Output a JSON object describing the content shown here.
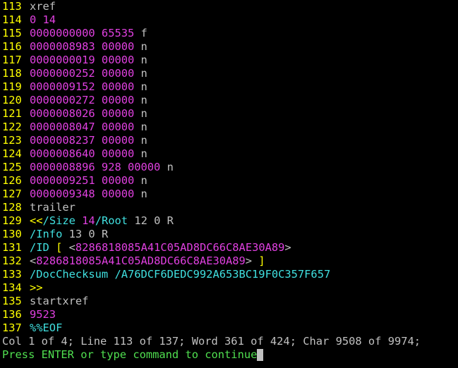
{
  "colors": {
    "background": "#000000",
    "line_number": "#ffff00",
    "plain": "#c0c0c0",
    "number": "#e040e0",
    "keyword": "#40e0e0",
    "bracket": "#ffff00",
    "prompt": "#50e050"
  },
  "lines": [
    {
      "n": "113",
      "segs": [
        {
          "t": "xref",
          "c": "plain"
        }
      ]
    },
    {
      "n": "114",
      "segs": [
        {
          "t": "0 14",
          "c": "num"
        }
      ]
    },
    {
      "n": "115",
      "segs": [
        {
          "t": "0000000000 65535 ",
          "c": "num"
        },
        {
          "t": "f",
          "c": "plain"
        }
      ]
    },
    {
      "n": "116",
      "segs": [
        {
          "t": "0000008983 00000 ",
          "c": "num"
        },
        {
          "t": "n",
          "c": "plain"
        }
      ]
    },
    {
      "n": "117",
      "segs": [
        {
          "t": "0000000019 00000 ",
          "c": "num"
        },
        {
          "t": "n",
          "c": "plain"
        }
      ]
    },
    {
      "n": "118",
      "segs": [
        {
          "t": "0000000252 00000 ",
          "c": "num"
        },
        {
          "t": "n",
          "c": "plain"
        }
      ]
    },
    {
      "n": "119",
      "segs": [
        {
          "t": "0000009152 00000 ",
          "c": "num"
        },
        {
          "t": "n",
          "c": "plain"
        }
      ]
    },
    {
      "n": "120",
      "segs": [
        {
          "t": "0000000272 00000 ",
          "c": "num"
        },
        {
          "t": "n",
          "c": "plain"
        }
      ]
    },
    {
      "n": "121",
      "segs": [
        {
          "t": "0000008026 00000 ",
          "c": "num"
        },
        {
          "t": "n",
          "c": "plain"
        }
      ]
    },
    {
      "n": "122",
      "segs": [
        {
          "t": "0000008047 00000 ",
          "c": "num"
        },
        {
          "t": "n",
          "c": "plain"
        }
      ]
    },
    {
      "n": "123",
      "segs": [
        {
          "t": "0000008237 00000 ",
          "c": "num"
        },
        {
          "t": "n",
          "c": "plain"
        }
      ]
    },
    {
      "n": "124",
      "segs": [
        {
          "t": "0000008640 00000 ",
          "c": "num"
        },
        {
          "t": "n",
          "c": "plain"
        }
      ]
    },
    {
      "n": "125",
      "segs": [
        {
          "t": "0000008896 928 00000 ",
          "c": "num"
        },
        {
          "t": "n",
          "c": "plain"
        }
      ]
    },
    {
      "n": "126",
      "segs": [
        {
          "t": "0000009251 00000 ",
          "c": "num"
        },
        {
          "t": "n",
          "c": "plain"
        }
      ]
    },
    {
      "n": "127",
      "segs": [
        {
          "t": "0000009348 00000 ",
          "c": "num"
        },
        {
          "t": "n",
          "c": "plain"
        }
      ]
    },
    {
      "n": "128",
      "segs": [
        {
          "t": "trailer",
          "c": "plain"
        }
      ]
    },
    {
      "n": "129",
      "segs": [
        {
          "t": "<<",
          "c": "yel"
        },
        {
          "t": "/Size ",
          "c": "kw"
        },
        {
          "t": "14",
          "c": "num"
        },
        {
          "t": "/Root ",
          "c": "kw"
        },
        {
          "t": "12 0 R",
          "c": "plain"
        }
      ]
    },
    {
      "n": "130",
      "segs": [
        {
          "t": "/Info ",
          "c": "kw"
        },
        {
          "t": "13 0 R",
          "c": "plain"
        }
      ]
    },
    {
      "n": "131",
      "segs": [
        {
          "t": "/ID ",
          "c": "kw"
        },
        {
          "t": "[ ",
          "c": "yel"
        },
        {
          "t": "<",
          "c": "plain"
        },
        {
          "t": "8286818085A41C05AD8DC66C8AE30A89",
          "c": "num"
        },
        {
          "t": ">",
          "c": "plain"
        }
      ]
    },
    {
      "n": "132",
      "segs": [
        {
          "t": "<",
          "c": "plain"
        },
        {
          "t": "8286818085A41C05AD8DC66C8AE30A89",
          "c": "num"
        },
        {
          "t": "> ",
          "c": "plain"
        },
        {
          "t": "]",
          "c": "yel"
        }
      ]
    },
    {
      "n": "133",
      "segs": [
        {
          "t": "/DocChecksum /A76DCF6DEDC992A653BC19F0C357F657",
          "c": "kw"
        }
      ]
    },
    {
      "n": "134",
      "segs": [
        {
          "t": ">>",
          "c": "yel"
        }
      ]
    },
    {
      "n": "135",
      "segs": [
        {
          "t": "startxref",
          "c": "plain"
        }
      ]
    },
    {
      "n": "136",
      "segs": [
        {
          "t": "9523",
          "c": "num"
        }
      ]
    },
    {
      "n": "137",
      "segs": [
        {
          "t": "%%EOF",
          "c": "kw"
        }
      ]
    }
  ],
  "status": "Col 1 of 4; Line 113 of 137; Word 361 of 424; Char 9508 of 9974;",
  "prompt": "Press ENTER or type command to continue"
}
